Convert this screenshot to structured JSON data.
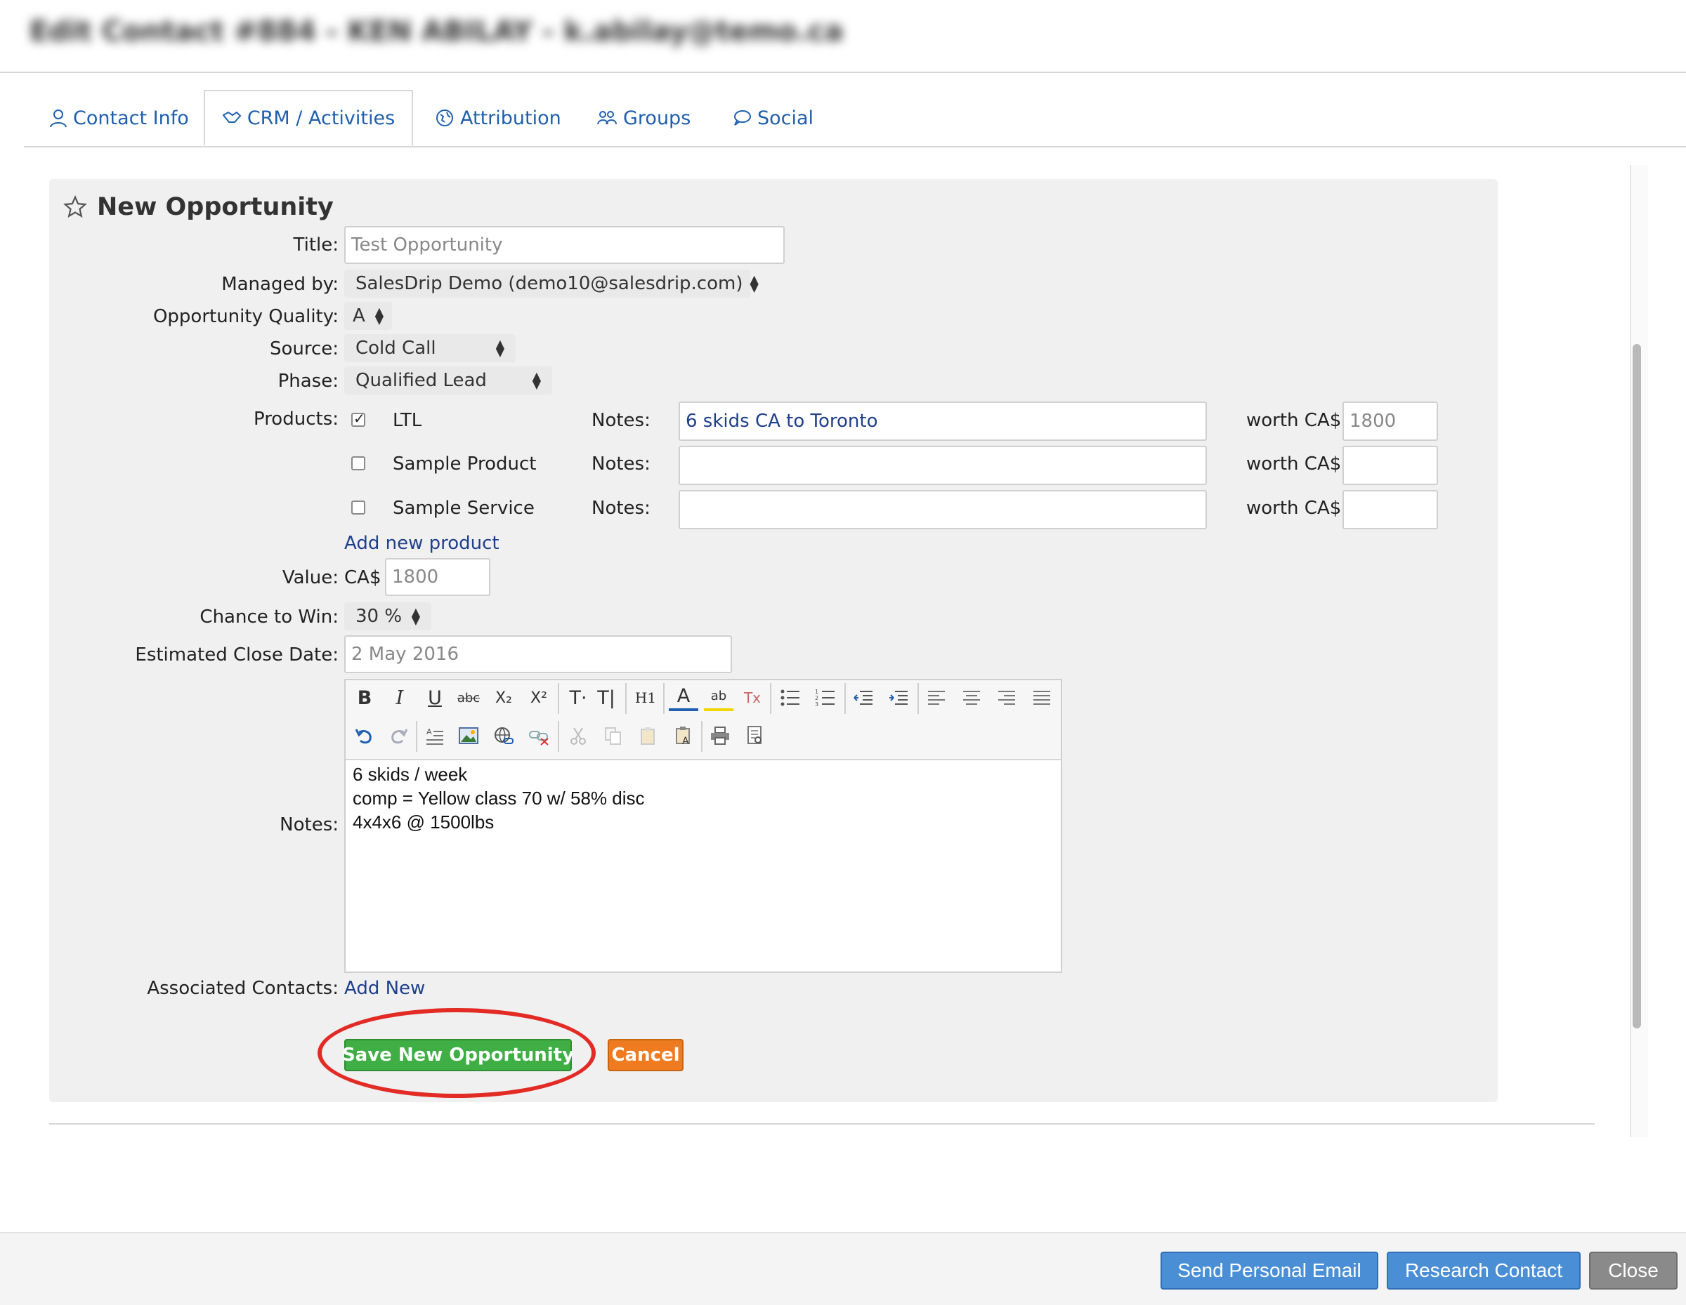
{
  "window": {
    "title": "Edit Contact #884 - KEN ABILAY - k.abilay@temo.ca"
  },
  "tabs": [
    {
      "label": "Contact Info",
      "icon": "user-icon"
    },
    {
      "label": "CRM / Activities",
      "icon": "handshake-icon",
      "active": true
    },
    {
      "label": "Attribution",
      "icon": "globe-icon"
    },
    {
      "label": "Groups",
      "icon": "group-icon"
    },
    {
      "label": "Social",
      "icon": "speech-bubble-icon"
    }
  ],
  "form": {
    "heading": "New Opportunity",
    "title_label": "Title:",
    "title_placeholder": "Test Opportunity",
    "managed_by_label": "Managed by:",
    "managed_by_value": "SalesDrip Demo (demo10@salesdrip.com)",
    "quality_label": "Opportunity Quality:",
    "quality_value": "A",
    "source_label": "Source:",
    "source_value": "Cold Call",
    "phase_label": "Phase:",
    "phase_value": "Qualified Lead",
    "products_label": "Products:",
    "products": [
      {
        "name": "LTL",
        "checked": true,
        "notes_label": "Notes:",
        "notes": "6 skids CA to Toronto",
        "worth_label": "worth CA$",
        "worth": "1800"
      },
      {
        "name": "Sample Product",
        "checked": false,
        "notes_label": "Notes:",
        "notes": "",
        "worth_label": "worth CA$",
        "worth": ""
      },
      {
        "name": "Sample Service",
        "checked": false,
        "notes_label": "Notes:",
        "notes": "",
        "worth_label": "worth CA$",
        "worth": ""
      }
    ],
    "add_product_link": "Add new product",
    "value_label": "Value:",
    "value_currency": "CA$",
    "value_placeholder": "1800",
    "chance_label": "Chance to Win:",
    "chance_value": "30 %",
    "close_date_label": "Estimated Close Date:",
    "close_date_placeholder": "2 May 2016",
    "notes_label": "Notes:",
    "notes_lines": [
      "6 skids / week",
      "comp = Yellow class 70 w/ 58% disc",
      "4x4x6 @ 1500lbs"
    ],
    "associated_label": "Associated Contacts:",
    "associated_link": "Add New",
    "save_label": "Save New Opportunity",
    "cancel_label": "Cancel"
  },
  "editor_toolbar": {
    "row1": [
      "bold-icon",
      "italic-icon",
      "underline-icon",
      "strikethrough-icon",
      "subscript-icon",
      "superscript-icon",
      "font-size-icon",
      "font-size-alt-icon",
      "heading-icon",
      "text-color-icon",
      "highlight-icon",
      "remove-format-icon",
      "bullet-list-icon",
      "numbered-list-icon",
      "outdent-icon",
      "indent-icon",
      "align-left-icon",
      "align-center-icon",
      "align-right-icon",
      "justify-icon"
    ],
    "row2": [
      "undo-icon",
      "redo-icon",
      "find-replace-icon",
      "image-icon",
      "link-icon",
      "unlink-icon",
      "cut-icon",
      "copy-icon",
      "paste-icon",
      "paste-text-icon",
      "print-icon",
      "preview-icon"
    ],
    "glyphs": {
      "bold": "B",
      "italic": "I",
      "underline": "U",
      "strike": "abc",
      "sub": "X₂",
      "sup": "X²",
      "t1": "T·",
      "t2": "T|",
      "h1": "H1",
      "color": "A",
      "hl": "ab",
      "clear": "Tx"
    }
  },
  "footer": {
    "send_email": "Send Personal Email",
    "research": "Research Contact",
    "close": "Close"
  },
  "colors": {
    "link": "#1f3f8c",
    "tab_text": "#1f5fae",
    "save_green": "#3fae45",
    "cancel_orange": "#ee7b20",
    "highlight_red": "#e32b26",
    "footer_blue": "#4a8fd6"
  }
}
